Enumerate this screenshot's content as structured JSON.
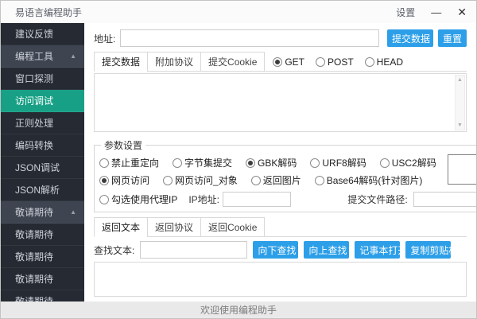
{
  "titlebar": {
    "title": "易语言编程助手",
    "settings_label": "设置",
    "minimize_glyph": "—",
    "close_glyph": "✕"
  },
  "sidebar": {
    "collapse_glyph": "▲",
    "items": [
      {
        "label": "建议反馈",
        "type": "item"
      },
      {
        "label": "编程工具",
        "type": "group"
      },
      {
        "label": "窗口探测",
        "type": "item"
      },
      {
        "label": "访问调试",
        "type": "item",
        "active": true
      },
      {
        "label": "正则处理",
        "type": "item"
      },
      {
        "label": "编码转换",
        "type": "item"
      },
      {
        "label": "JSON调试",
        "type": "item"
      },
      {
        "label": "JSON解析",
        "type": "item"
      },
      {
        "label": "敬请期待",
        "type": "group"
      },
      {
        "label": "敬请期待",
        "type": "item"
      },
      {
        "label": "敬请期待",
        "type": "item"
      },
      {
        "label": "敬请期待",
        "type": "item"
      },
      {
        "label": "敬请期待",
        "type": "item"
      }
    ]
  },
  "address": {
    "label": "地址:",
    "value": "",
    "submit_label": "提交数据",
    "reset_label": "重置"
  },
  "request": {
    "tabs": [
      "提交数据",
      "附加协议",
      "提交Cookie"
    ],
    "active_tab": "提交数据",
    "methods": [
      {
        "label": "GET",
        "selected": true
      },
      {
        "label": "POST",
        "selected": false
      },
      {
        "label": "HEAD",
        "selected": false
      }
    ],
    "body": ""
  },
  "params": {
    "legend": "参数设置",
    "row1": [
      {
        "label": "禁止重定向",
        "selected": false
      },
      {
        "label": "字节集提交",
        "selected": false
      },
      {
        "label": "GBK解码",
        "selected": true
      },
      {
        "label": "URF8解码",
        "selected": false
      },
      {
        "label": "USC2解码",
        "selected": false
      }
    ],
    "row2": [
      {
        "label": "网页访问",
        "selected": true
      },
      {
        "label": "网页访问_对象",
        "selected": false
      },
      {
        "label": "返回图片",
        "selected": false
      },
      {
        "label": "Base64解码(针对图片)",
        "selected": false
      }
    ],
    "proxy": {
      "label": "勾选使用代理IP",
      "selected": false,
      "ip_label": "IP地址:",
      "ip_value": ""
    },
    "file": {
      "label": "提交文件路径:",
      "value": "",
      "browse_label": "..."
    }
  },
  "response": {
    "tabs": [
      "返回文本",
      "返回协议",
      "返回Cookie"
    ],
    "active_tab": "返回文本",
    "find_label": "查找文本:",
    "find_value": "",
    "buttons": [
      "向下查找",
      "向上查找",
      "记事本打开",
      "复制剪贴板"
    ],
    "body": ""
  },
  "scrollbar": {
    "up_glyph": "▲",
    "down_glyph": "▼"
  },
  "statusbar": {
    "text": "欢迎使用编程助手"
  },
  "colors": {
    "accent_teal": "#17a086",
    "accent_blue": "#2d9fe8",
    "sidebar_bg": "#262a33",
    "sidebar_group_bg": "#3e4450"
  }
}
